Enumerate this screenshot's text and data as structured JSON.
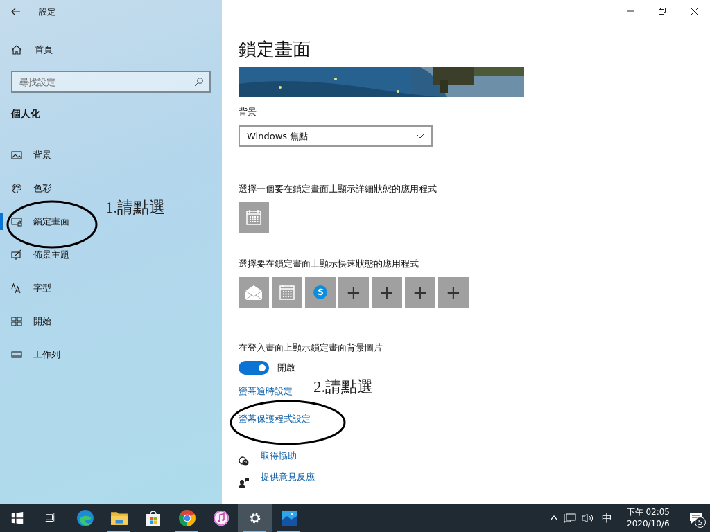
{
  "window": {
    "title": "設定"
  },
  "sidebar": {
    "home": "首頁",
    "search": {
      "placeholder": "尋找設定"
    },
    "section": "個人化",
    "items": [
      {
        "kind": "picture",
        "label": "背景",
        "selected": false
      },
      {
        "kind": "palette",
        "label": "色彩",
        "selected": false
      },
      {
        "kind": "lock",
        "label": "鎖定畫面",
        "selected": true
      },
      {
        "kind": "theme",
        "label": "佈景主題",
        "selected": false
      },
      {
        "kind": "font",
        "label": "字型",
        "selected": false
      },
      {
        "kind": "start",
        "label": "開始",
        "selected": false
      },
      {
        "kind": "taskbar",
        "label": "工作列",
        "selected": false
      }
    ]
  },
  "content": {
    "title": "鎖定畫面",
    "background_label": "背景",
    "background_value": "Windows 焦點",
    "detailed_label": "選擇一個要在鎖定畫面上顯示詳細狀態的應用程式",
    "detailed_apps": [
      {
        "kind": "calendar"
      }
    ],
    "quick_label": "選擇要在鎖定畫面上顯示快速狀態的應用程式",
    "quick_apps": [
      {
        "kind": "mail"
      },
      {
        "kind": "calendar"
      },
      {
        "kind": "skype"
      },
      {
        "kind": "add",
        "label": "+"
      },
      {
        "kind": "add",
        "label": "+"
      },
      {
        "kind": "add",
        "label": "+"
      },
      {
        "kind": "add",
        "label": "+"
      }
    ],
    "signin_label": "在登入畫面上顯示鎖定畫面背景圖片",
    "signin_toggle": {
      "on": true,
      "label": "開啟"
    },
    "links": [
      "螢幕逾時設定",
      "螢幕保護程式設定"
    ],
    "help": [
      {
        "kind": "help",
        "label": "取得協助"
      },
      {
        "kind": "feedback",
        "label": "提供意見反應"
      }
    ]
  },
  "annotations": [
    {
      "text": "1.請點選"
    },
    {
      "text": "2.請點選"
    }
  ],
  "taskbar": {
    "apps": [
      {
        "kind": "start",
        "running": false,
        "active": false
      },
      {
        "kind": "taskview",
        "running": false,
        "active": false
      },
      {
        "kind": "edge",
        "running": false,
        "active": false
      },
      {
        "kind": "explorer",
        "running": true,
        "active": false
      },
      {
        "kind": "store",
        "running": false,
        "active": false
      },
      {
        "kind": "chrome",
        "running": true,
        "active": false
      },
      {
        "kind": "music",
        "running": false,
        "active": false
      },
      {
        "kind": "settings",
        "running": true,
        "active": true
      },
      {
        "kind": "photos",
        "running": true,
        "active": false
      }
    ],
    "ime": "中",
    "time": "下午 02:05",
    "date": "2020/10/6",
    "notifications": "5"
  }
}
